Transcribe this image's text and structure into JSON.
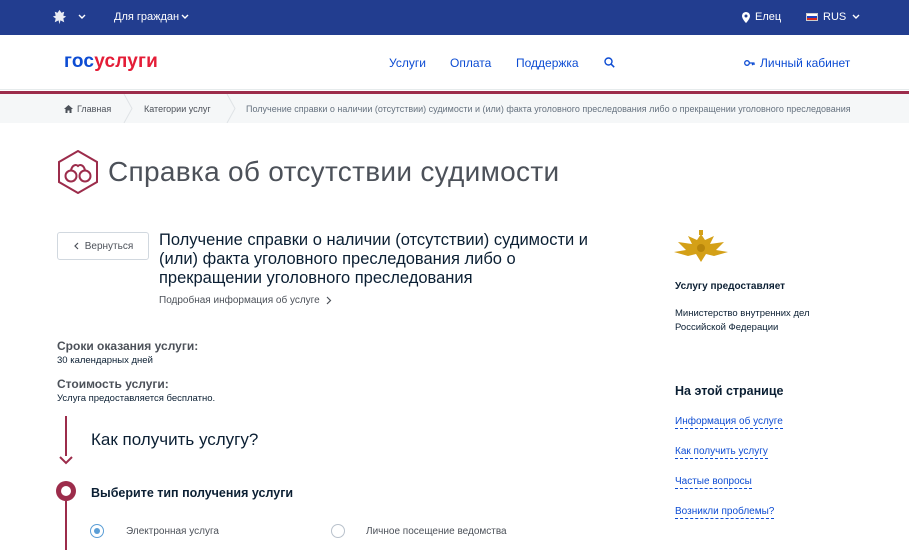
{
  "topbar": {
    "audience": "Для граждан",
    "city": "Елец",
    "language": "RUS",
    "colors": {
      "background": "#223d8f"
    }
  },
  "header": {
    "logo_part1": "гос",
    "logo_part2": "услуги",
    "nav": [
      "Услуги",
      "Оплата",
      "Поддержка"
    ],
    "search_icon": "search-icon",
    "cabinet": "Личный кабинет"
  },
  "breadcrumbs": [
    "Главная",
    "Категории услуг",
    "Получение справки о наличии (отсутствии) судимости и (или) факта уголовного преследования либо о прекращении уголовного преследования"
  ],
  "page": {
    "title": "Справка об отсутствии судимости",
    "back_button": "Вернуться",
    "service_title": "Получение справки о наличии (отсутствии) судимости и (или) факта уголовного преследования либо о прекращении уголовного преследования",
    "more_info": "Подробная информация об услуге",
    "terms_label": "Сроки оказания услуги:",
    "terms_value": "30 календарных дней",
    "cost_label": "Стоимость услуги:",
    "cost_value": "Услуга предоставляется бесплатно.",
    "how_to_get": "Как получить услугу?",
    "step_title": "Выберите тип получения услуги",
    "options": [
      {
        "label": "Электронная услуга",
        "selected": true
      },
      {
        "label": "Личное посещение ведомства",
        "selected": false
      }
    ]
  },
  "sidebar": {
    "provider_heading": "Услугу предоставляет",
    "provider_name": "Министерство внутренних дел Российской Федерации",
    "onpage_heading": "На этой странице",
    "links": [
      "Информация об услуге",
      "Как получить услугу",
      "Частые вопросы",
      "Возникли проблемы?"
    ]
  },
  "colors": {
    "accent": "#9c2c4b",
    "link": "#0d4cd3",
    "logo_red": "#e41d37"
  }
}
